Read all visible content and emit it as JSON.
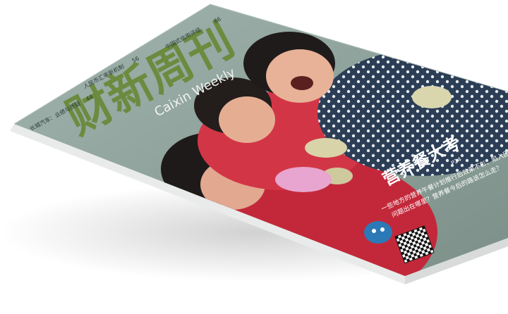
{
  "magazine": {
    "masthead_cn": "财新周刊",
    "masthead_en": "Caixin Weekly",
    "feature_title": "营养餐大考",
    "feature_page": "P24",
    "feature_subtitle_1": "一些地方的营养午餐计划推行后效果不彰、陷入困境，",
    "feature_subtitle_2": "问题出在哪里？营养餐今后的路该怎么走？",
    "colors": {
      "cover_bg": "#8fa39c",
      "masthead": "#6c8b3f",
      "accent_red": "#c8283a"
    }
  },
  "cover_lines": [
    {
      "text": "长城汽车：业绩与质疑",
      "page": "44"
    },
    {
      "text": "人民币汇率新机制",
      "page": "56"
    },
    {
      "text": "中国式信用评级",
      "page": "66"
    }
  ]
}
